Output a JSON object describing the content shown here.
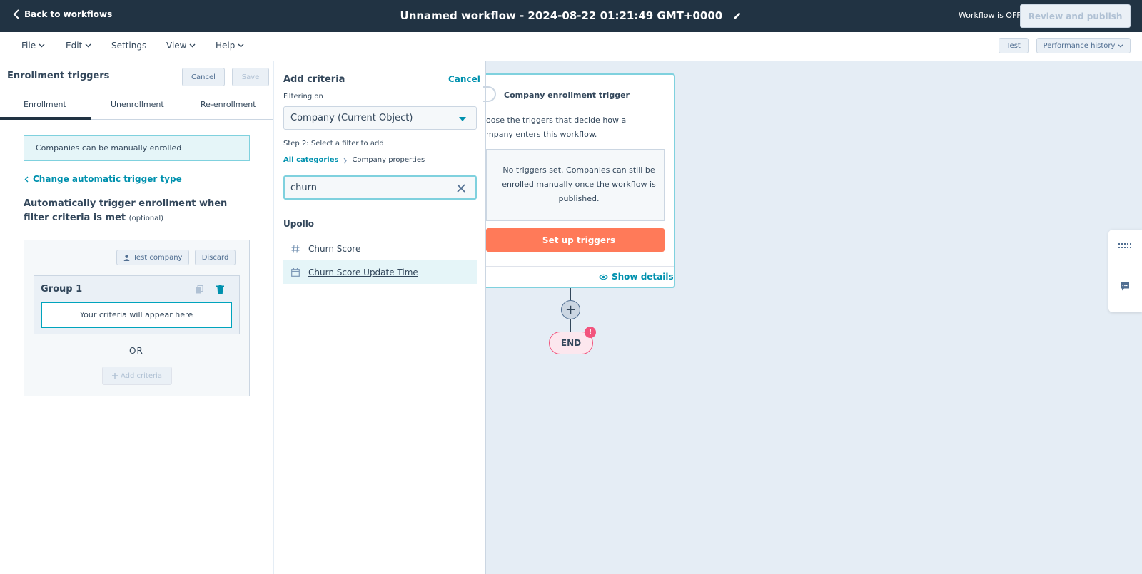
{
  "topbar": {
    "back_label": "Back to workflows",
    "title": "Unnamed workflow - 2024-08-22 01:21:49 GMT+0000",
    "status": "Workflow is OFF",
    "publish_label": "Review and publish"
  },
  "menubar": {
    "items": [
      "File",
      "Edit",
      "Settings",
      "View",
      "Help"
    ],
    "test_label": "Test",
    "history_label": "Performance history"
  },
  "enrollment": {
    "title": "Enrollment triggers",
    "cancel_label": "Cancel",
    "save_label": "Save",
    "tabs": [
      "Enrollment",
      "Unenrollment",
      "Re-enrollment"
    ],
    "manual_note": "Companies can be manually enrolled",
    "change_link": "Change automatic trigger type",
    "auto_heading": "Automatically trigger enrollment when filter criteria is met",
    "optional": "(optional)",
    "test_company_label": "Test company",
    "discard_label": "Discard",
    "group_title": "Group 1",
    "placeholder": "Your criteria will appear here",
    "or_label": "OR",
    "add_criteria_label": "Add criteria"
  },
  "add_criteria": {
    "title": "Add criteria",
    "cancel_label": "Cancel",
    "filtering_on_label": "Filtering on",
    "filtering_on_value": "Company (Current Object)",
    "step_label": "Step 2: Select a filter to add",
    "crumb_all": "All categories",
    "crumb_current": "Company properties",
    "search_value": "churn",
    "section": "Upollo",
    "results": [
      {
        "label": "Churn Score",
        "icon": "hash-icon"
      },
      {
        "label": "Churn Score Update Time",
        "icon": "calendar-icon"
      }
    ]
  },
  "canvas": {
    "card_title": "Company enrollment trigger",
    "card_desc": "oose the triggers that decide how a mpany enters this workflow.",
    "card_desc_line1": "oose the triggers that decide how a",
    "card_desc_line2": "mpany enters this workflow.",
    "empty_text": "No triggers set. Companies can still be enrolled manually once the workflow is published.",
    "setup_label": "Set up triggers",
    "show_details": "Show details",
    "plus_label": "+",
    "end_label": "END",
    "end_badge": "!"
  },
  "colors": {
    "topbar": "#213343",
    "accent": "#0091ae",
    "cta": "#ff7a59",
    "highlight": "#e5f5f8"
  }
}
